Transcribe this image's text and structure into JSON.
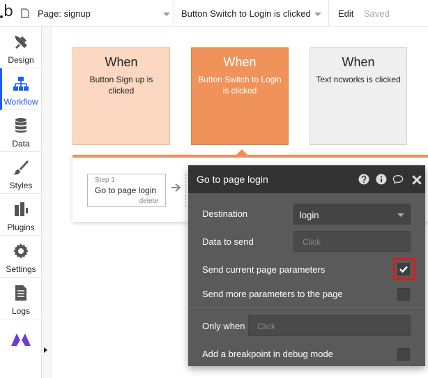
{
  "topbar": {
    "logo_text": "b",
    "page_selector": "Page: signup",
    "event_selector": "Button Switch to Login is clicked",
    "edit_label": "Edit",
    "saved_label": "Saved"
  },
  "sidebar": {
    "items": [
      {
        "label": "Design",
        "icon": "design-icon"
      },
      {
        "label": "Workflow",
        "icon": "workflow-icon",
        "active": true
      },
      {
        "label": "Data",
        "icon": "database-icon"
      },
      {
        "label": "Styles",
        "icon": "brush-icon"
      },
      {
        "label": "Plugins",
        "icon": "plugin-icon"
      },
      {
        "label": "Settings",
        "icon": "gear-icon"
      },
      {
        "label": "Logs",
        "icon": "document-icon"
      },
      {
        "label": "",
        "icon": "bubble-logo-icon"
      }
    ]
  },
  "events": [
    {
      "when": "When",
      "desc": "Button Sign up is clicked"
    },
    {
      "when": "When",
      "desc": "Button Switch to Login is clicked"
    },
    {
      "when": "When",
      "desc": "Text ncworks is clicked"
    }
  ],
  "step": {
    "number": "Step 1",
    "name": "Go to page login",
    "delete": "delete"
  },
  "panel": {
    "title": "Go to page login",
    "destination_label": "Destination",
    "destination_value": "login",
    "data_to_send_label": "Data to send",
    "data_to_send_placeholder": "Click",
    "send_current_params_label": "Send current page parameters",
    "send_current_params_checked": true,
    "send_more_params_label": "Send more parameters to the page",
    "only_when_label": "Only when",
    "only_when_placeholder": "Click",
    "breakpoint_label": "Add a breakpoint in debug mode"
  },
  "colors": {
    "accent": "#f0935b",
    "active_blue": "#1a5cff",
    "highlight_red": "#e2181c"
  }
}
